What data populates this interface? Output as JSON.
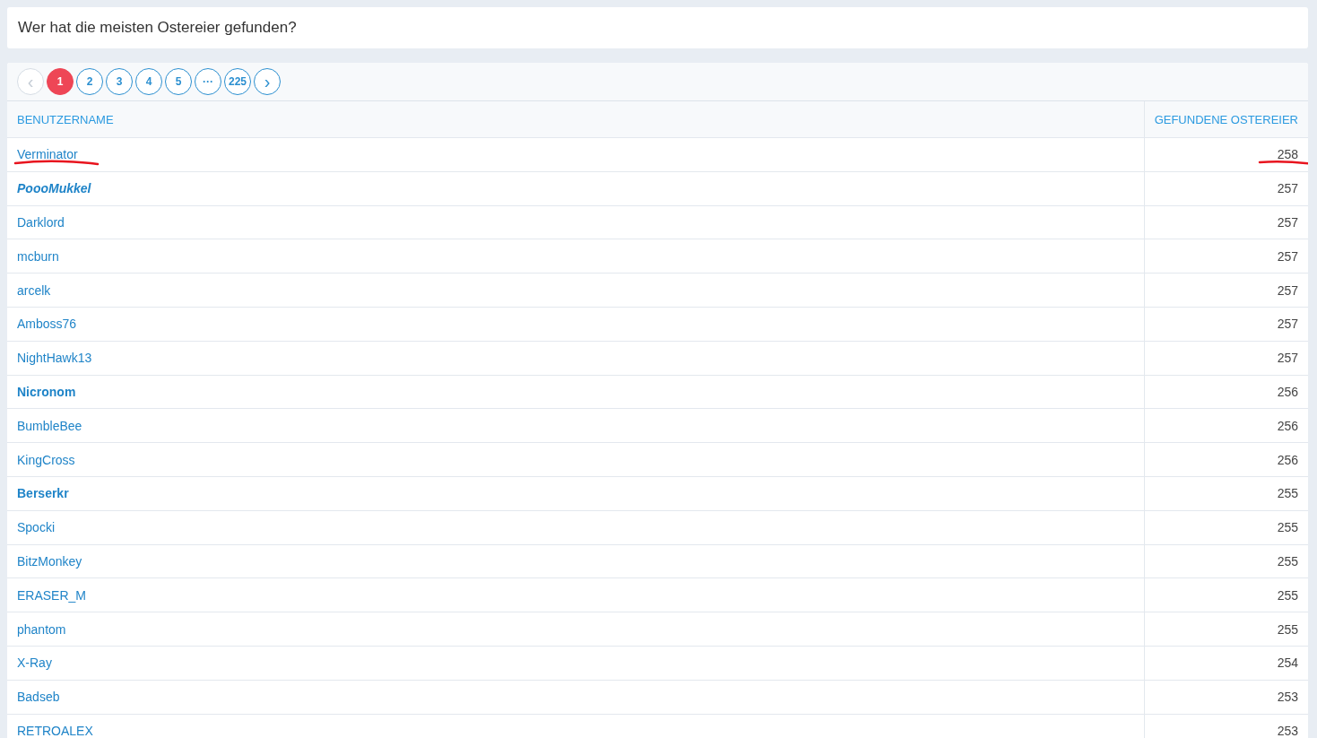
{
  "title": "Wer hat die meisten Ostereier gefunden?",
  "pagination": {
    "prev": {
      "label": "‹",
      "disabled": true
    },
    "pages": [
      {
        "label": "1",
        "selected": true
      },
      {
        "label": "2",
        "selected": false
      },
      {
        "label": "3",
        "selected": false
      },
      {
        "label": "4",
        "selected": false
      },
      {
        "label": "5",
        "selected": false
      },
      {
        "label": "···",
        "selected": false
      },
      {
        "label": "225",
        "selected": false
      }
    ],
    "next": {
      "label": "›",
      "disabled": false
    }
  },
  "table": {
    "columns": [
      "BENUTZERNAME",
      "GEFUNDENE OSTEREIER"
    ],
    "rows": [
      {
        "name": "Verminator",
        "kind": "normal",
        "eggs": "258",
        "marked": true
      },
      {
        "name": "PoooMukkel",
        "kind": "bold-italic",
        "eggs": "257",
        "marked": false
      },
      {
        "name": "Darklord",
        "kind": "normal",
        "eggs": "257",
        "marked": false
      },
      {
        "name": "mcburn",
        "kind": "normal",
        "eggs": "257",
        "marked": false
      },
      {
        "name": "arcelk",
        "kind": "normal",
        "eggs": "257",
        "marked": false
      },
      {
        "name": "Amboss76",
        "kind": "normal",
        "eggs": "257",
        "marked": false
      },
      {
        "name": "NightHawk13",
        "kind": "normal",
        "eggs": "257",
        "marked": false
      },
      {
        "name": "Nicronom",
        "kind": "bold",
        "eggs": "256",
        "marked": false
      },
      {
        "name": "BumbleBee",
        "kind": "normal",
        "eggs": "256",
        "marked": false
      },
      {
        "name": "KingCross",
        "kind": "normal",
        "eggs": "256",
        "marked": false
      },
      {
        "name": "Berserkr",
        "kind": "bold",
        "eggs": "255",
        "marked": false
      },
      {
        "name": "Spocki",
        "kind": "normal",
        "eggs": "255",
        "marked": false
      },
      {
        "name": "BitzMonkey",
        "kind": "normal",
        "eggs": "255",
        "marked": false
      },
      {
        "name": "ERASER_M",
        "kind": "normal",
        "eggs": "255",
        "marked": false
      },
      {
        "name": "phantom",
        "kind": "normal",
        "eggs": "255",
        "marked": false
      },
      {
        "name": "X-Ray",
        "kind": "normal",
        "eggs": "254",
        "marked": false
      },
      {
        "name": "Badseb",
        "kind": "normal",
        "eggs": "253",
        "marked": false
      },
      {
        "name": "RETROALEX",
        "kind": "normal",
        "eggs": "253",
        "marked": false
      }
    ]
  }
}
